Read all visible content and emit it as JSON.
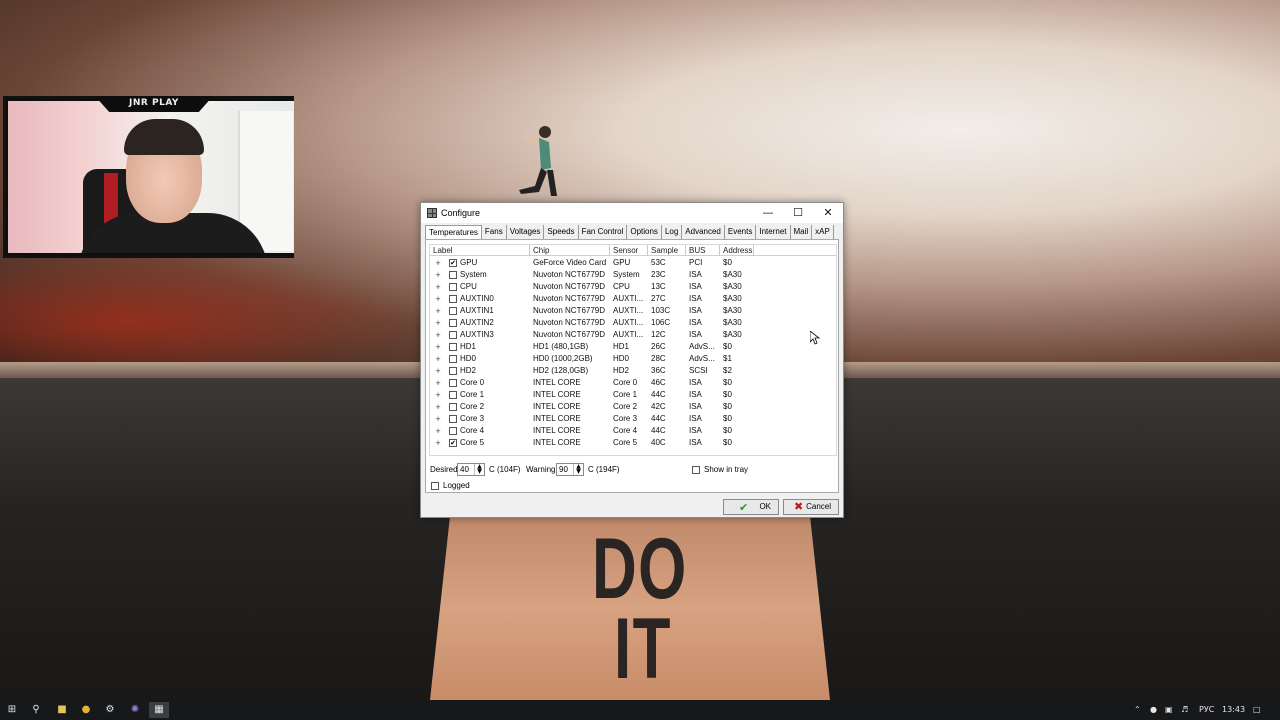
{
  "wallpaper": {
    "line1": "DO",
    "line2": "IT"
  },
  "webcam": {
    "badge": "JNR PLAY"
  },
  "dialog": {
    "title": "Configure",
    "tabs": [
      "Temperatures",
      "Fans",
      "Voltages",
      "Speeds",
      "Fan Control",
      "Options",
      "Log",
      "Advanced",
      "Events",
      "Internet",
      "Mail",
      "xAP"
    ],
    "active_tab": "Temperatures",
    "columns": [
      "Label",
      "Chip",
      "Sensor",
      "Sample",
      "BUS",
      "Address"
    ],
    "rows": [
      {
        "checked": true,
        "label": "GPU",
        "chip": "GeForce Video Card",
        "sensor": "GPU",
        "sample": "53C",
        "bus": "PCI",
        "address": "$0"
      },
      {
        "checked": false,
        "label": "System",
        "chip": "Nuvoton NCT6779D",
        "sensor": "System",
        "sample": "23C",
        "bus": "ISA",
        "address": "$A30"
      },
      {
        "checked": false,
        "label": "CPU",
        "chip": "Nuvoton NCT6779D",
        "sensor": "CPU",
        "sample": "13C",
        "bus": "ISA",
        "address": "$A30"
      },
      {
        "checked": false,
        "label": "AUXTIN0",
        "chip": "Nuvoton NCT6779D",
        "sensor": "AUXTI...",
        "sample": "27C",
        "bus": "ISA",
        "address": "$A30"
      },
      {
        "checked": false,
        "label": "AUXTIN1",
        "chip": "Nuvoton NCT6779D",
        "sensor": "AUXTI...",
        "sample": "103C",
        "bus": "ISA",
        "address": "$A30"
      },
      {
        "checked": false,
        "label": "AUXTIN2",
        "chip": "Nuvoton NCT6779D",
        "sensor": "AUXTI...",
        "sample": "106C",
        "bus": "ISA",
        "address": "$A30"
      },
      {
        "checked": false,
        "label": "AUXTIN3",
        "chip": "Nuvoton NCT6779D",
        "sensor": "AUXTI...",
        "sample": "12C",
        "bus": "ISA",
        "address": "$A30"
      },
      {
        "checked": false,
        "label": "HD1",
        "chip": "HD1 (480,1GB)",
        "sensor": "HD1",
        "sample": "26C",
        "bus": "AdvS...",
        "address": "$0"
      },
      {
        "checked": false,
        "label": "HD0",
        "chip": "HD0 (1000,2GB)",
        "sensor": "HD0",
        "sample": "28C",
        "bus": "AdvS...",
        "address": "$1"
      },
      {
        "checked": false,
        "label": "HD2",
        "chip": "HD2 (128,0GB)",
        "sensor": "HD2",
        "sample": "36C",
        "bus": "SCSI",
        "address": "$2"
      },
      {
        "checked": false,
        "label": "Core 0",
        "chip": "INTEL CORE",
        "sensor": "Core 0",
        "sample": "46C",
        "bus": "ISA",
        "address": "$0"
      },
      {
        "checked": false,
        "label": "Core 1",
        "chip": "INTEL CORE",
        "sensor": "Core 1",
        "sample": "44C",
        "bus": "ISA",
        "address": "$0"
      },
      {
        "checked": false,
        "label": "Core 2",
        "chip": "INTEL CORE",
        "sensor": "Core 2",
        "sample": "42C",
        "bus": "ISA",
        "address": "$0"
      },
      {
        "checked": false,
        "label": "Core 3",
        "chip": "INTEL CORE",
        "sensor": "Core 3",
        "sample": "44C",
        "bus": "ISA",
        "address": "$0"
      },
      {
        "checked": false,
        "label": "Core 4",
        "chip": "INTEL CORE",
        "sensor": "Core 4",
        "sample": "44C",
        "bus": "ISA",
        "address": "$0"
      },
      {
        "checked": true,
        "label": "Core 5",
        "chip": "INTEL CORE",
        "sensor": "Core 5",
        "sample": "40C",
        "bus": "ISA",
        "address": "$0"
      }
    ],
    "desired": {
      "label": "Desired",
      "value": "40",
      "unit": "C (104F)"
    },
    "warning": {
      "label": "Warning",
      "value": "90",
      "unit": "C (194F)"
    },
    "show_in_tray": {
      "label": "Show in tray",
      "checked": false
    },
    "logged": {
      "label": "Logged",
      "checked": false
    },
    "ok_label": "OK",
    "cancel_label": "Cancel"
  },
  "taskbar": {
    "language": "РУС",
    "time": "13:43"
  },
  "colors": {
    "ok_check": "#1e9b2a",
    "cancel_x": "#c41818",
    "taskbar": "#17181a"
  }
}
